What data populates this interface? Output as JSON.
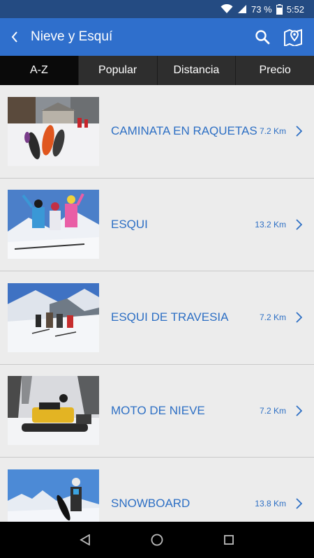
{
  "status_bar": {
    "battery_text": "73 %",
    "time": "5:52"
  },
  "app_bar": {
    "title": "Nieve y Esquí",
    "back_icon": "chevron-left-icon",
    "search_icon": "search-icon",
    "map_icon": "map-pin-icon"
  },
  "tabs": [
    {
      "label": "A-Z",
      "active": true
    },
    {
      "label": "Popular",
      "active": false
    },
    {
      "label": "Distancia",
      "active": false
    },
    {
      "label": "Precio",
      "active": false
    }
  ],
  "items": [
    {
      "label": "CAMINATA EN RAQUETAS",
      "distance": "7.2 Km",
      "image": "snowshoes-photo"
    },
    {
      "label": "ESQUI",
      "distance": "13.2 Km",
      "image": "skiers-photo"
    },
    {
      "label": "ESQUI DE TRAVESIA",
      "distance": "7.2 Km",
      "image": "ski-touring-photo"
    },
    {
      "label": "MOTO DE NIEVE",
      "distance": "7.2 Km",
      "image": "snowmobile-photo"
    },
    {
      "label": "SNOWBOARD",
      "distance": "13.8 Km",
      "image": "snowboard-photo"
    }
  ],
  "colors": {
    "status_bar": "#244b82",
    "app_bar": "#2f6fcc",
    "accent_text": "#2d6fc4",
    "tab_bg": "#2e2e2e",
    "tab_active_bg": "#0a0a0a"
  }
}
